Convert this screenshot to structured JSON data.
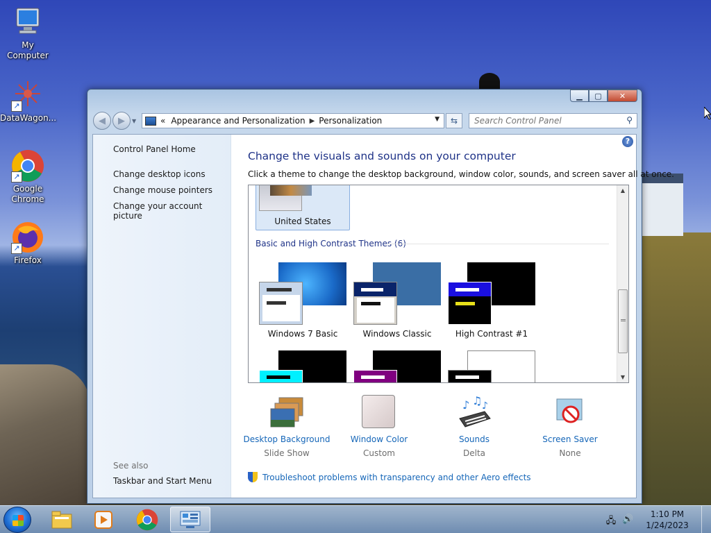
{
  "desktop": {
    "icons": [
      {
        "label": "My Computer",
        "icon": "computer-icon"
      },
      {
        "label": "DataWagon...",
        "icon": "datawagon-icon"
      },
      {
        "label": "Google Chrome",
        "icon": "chrome-icon"
      },
      {
        "label": "Firefox",
        "icon": "firefox-icon"
      }
    ]
  },
  "window": {
    "controls": {
      "minimize": "▁",
      "maximize": "▢",
      "close": "✕"
    },
    "nav": {
      "back": "◀",
      "forward": "▶",
      "breadcrumb_prefix": "«",
      "breadcrumb": [
        "Appearance and Personalization",
        "Personalization"
      ],
      "search_placeholder": "Search Control Panel"
    },
    "left_pane": {
      "links": [
        "Control Panel Home",
        "Change desktop icons",
        "Change mouse pointers",
        "Change your account picture"
      ],
      "see_also_label": "See also",
      "see_also_links": [
        "Taskbar and Start Menu"
      ]
    },
    "main": {
      "title": "Change the visuals and sounds on your computer",
      "subtitle": "Click a theme to change the desktop background, window color, sounds, and screen saver all at once.",
      "selected_theme": "United States",
      "section_heading": "Basic and High Contrast Themes (6)",
      "themes": [
        "Windows 7 Basic",
        "Windows Classic",
        "High Contrast #1"
      ],
      "bottom_items": [
        {
          "name": "Desktop Background",
          "value": "Slide Show"
        },
        {
          "name": "Window Color",
          "value": "Custom"
        },
        {
          "name": "Sounds",
          "value": "Delta"
        },
        {
          "name": "Screen Saver",
          "value": "None"
        }
      ],
      "troubleshoot_link": "Troubleshoot problems with transparency and other Aero effects"
    }
  },
  "taskbar": {
    "apps": [
      "file-explorer-icon",
      "media-player-icon",
      "chrome-icon",
      "control-panel-icon"
    ],
    "active_app": "control-panel-icon",
    "time": "1:10 PM",
    "date": "1/24/2023"
  },
  "colors": {
    "link": "#1566b8",
    "title": "#1e3287",
    "selection": "#dbe8f7"
  }
}
